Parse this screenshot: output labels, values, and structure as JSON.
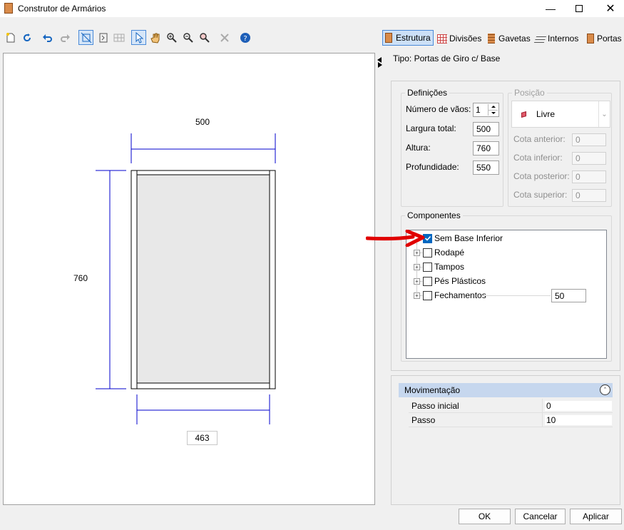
{
  "window": {
    "title": "Construtor de Armários"
  },
  "tabs": [
    {
      "label": "Estrutura",
      "icon": "panel-icon"
    },
    {
      "label": "Divisões",
      "icon": "grid-icon"
    },
    {
      "label": "Gavetas",
      "icon": "drawer-icon"
    },
    {
      "label": "Internos",
      "icon": "shelves-icon"
    },
    {
      "label": "Portas",
      "icon": "door-icon"
    }
  ],
  "drawing": {
    "width_top": "500",
    "height_left": "760",
    "width_bottom": "463"
  },
  "tipo": "Tipo: Portas de Giro c/ Base",
  "definicoes": {
    "legend": "Definições",
    "numero_vaos_label": "Número de vãos:",
    "numero_vaos": "1",
    "largura_label": "Largura total:",
    "largura": "500",
    "altura_label": "Altura:",
    "altura": "760",
    "profundidade_label": "Profundidade:",
    "profundidade": "550"
  },
  "posicao": {
    "legend": "Posição",
    "selected": "Livre",
    "cota_anterior_label": "Cota anterior:",
    "cota_anterior": "0",
    "cota_inferior_label": "Cota inferior:",
    "cota_inferior": "0",
    "cota_posterior_label": "Cota posterior:",
    "cota_posterior": "0",
    "cota_superior_label": "Cota superior:",
    "cota_superior": "0"
  },
  "componentes": {
    "legend": "Componentes",
    "items": [
      {
        "label": "Sem Base Inferior",
        "checked": true
      },
      {
        "label": "Rodapé",
        "checked": false
      },
      {
        "label": "Tampos",
        "checked": false
      },
      {
        "label": "Pés Plásticos",
        "checked": false
      },
      {
        "label": "Fechamentos",
        "checked": false,
        "value": "50"
      }
    ]
  },
  "movimentacao": {
    "header": "Movimentação",
    "rows": [
      {
        "label": "Passo inicial",
        "value": "0"
      },
      {
        "label": "Passo",
        "value": "10"
      }
    ]
  },
  "buttons": {
    "ok": "OK",
    "cancel": "Cancelar",
    "apply": "Aplicar"
  },
  "colors": {
    "accent": "#0067c0",
    "dimension": "#0000cc",
    "arrow": "#e00000",
    "section_header": "#c6d7ee"
  }
}
